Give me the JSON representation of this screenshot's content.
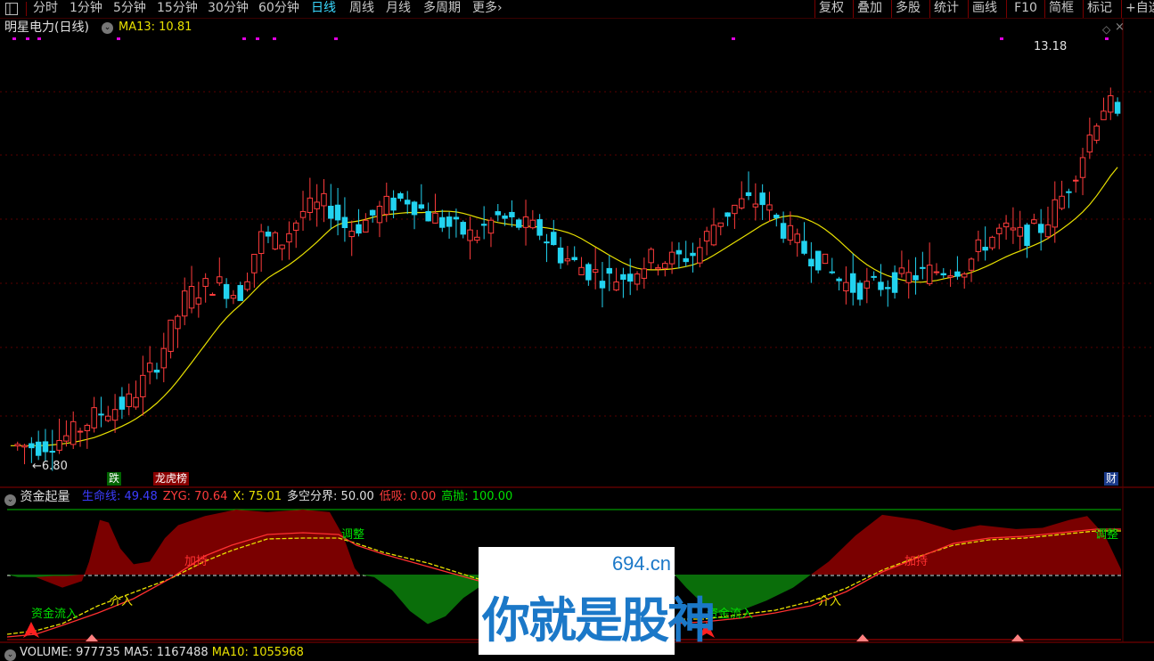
{
  "toolbar": {
    "periods": [
      "分时",
      "1分钟",
      "5分钟",
      "15分钟",
      "30分钟",
      "60分钟",
      "日线",
      "周线",
      "月线",
      "多周期",
      "更多"
    ],
    "active_period": "日线",
    "more_arrow": "›",
    "right_buttons": [
      "复权",
      "叠加",
      "多股",
      "统计",
      "画线",
      "F10",
      "简框",
      "标记",
      "+自选"
    ]
  },
  "main_panel": {
    "stock_title": "明星电力(日线)",
    "ma_label": "MA13: 10.81",
    "high_marker": "13.18",
    "low_marker": "6.80",
    "tags": {
      "die": "跌",
      "longhu": "龙虎榜",
      "cai": "财"
    },
    "colors": {
      "up": "#ff3c3c",
      "down": "#22d3f0",
      "ma": "#e8e000",
      "dots": "#e000e0"
    }
  },
  "indicator_panel": {
    "name": "资金起量",
    "lines": [
      {
        "label": "生命线",
        "value": "49.48",
        "color": "#3c3cff"
      },
      {
        "label": "ZYG",
        "value": "70.64",
        "color": "#ff3c3c"
      },
      {
        "label": "X",
        "value": "75.01",
        "color": "#e8e000"
      },
      {
        "label": "多空分界",
        "value": "50.00",
        "color": "#e0e0e0"
      },
      {
        "label": "低吸",
        "value": "0.00",
        "color": "#ff3c3c"
      },
      {
        "label": "高抛",
        "value": "100.00",
        "color": "#00e000"
      }
    ],
    "annotations": {
      "tiaozheng": "调整",
      "chiyou": "加持",
      "zijin": "资金流入",
      "jieru": "介入"
    }
  },
  "volume_panel": {
    "label": "VOLUME: 977735",
    "ma5": "MA5: 1167488",
    "ma10": "MA10: 1055968"
  },
  "watermark": {
    "url": "694.cn",
    "brand": "你就是股神"
  },
  "chart_data": {
    "type": "candlestick",
    "ma_line": "MA13",
    "high": 13.18,
    "low": 6.8,
    "ma13_last": 10.81,
    "grid": true,
    "series": [
      {
        "name": "MA13",
        "values": []
      }
    ]
  }
}
